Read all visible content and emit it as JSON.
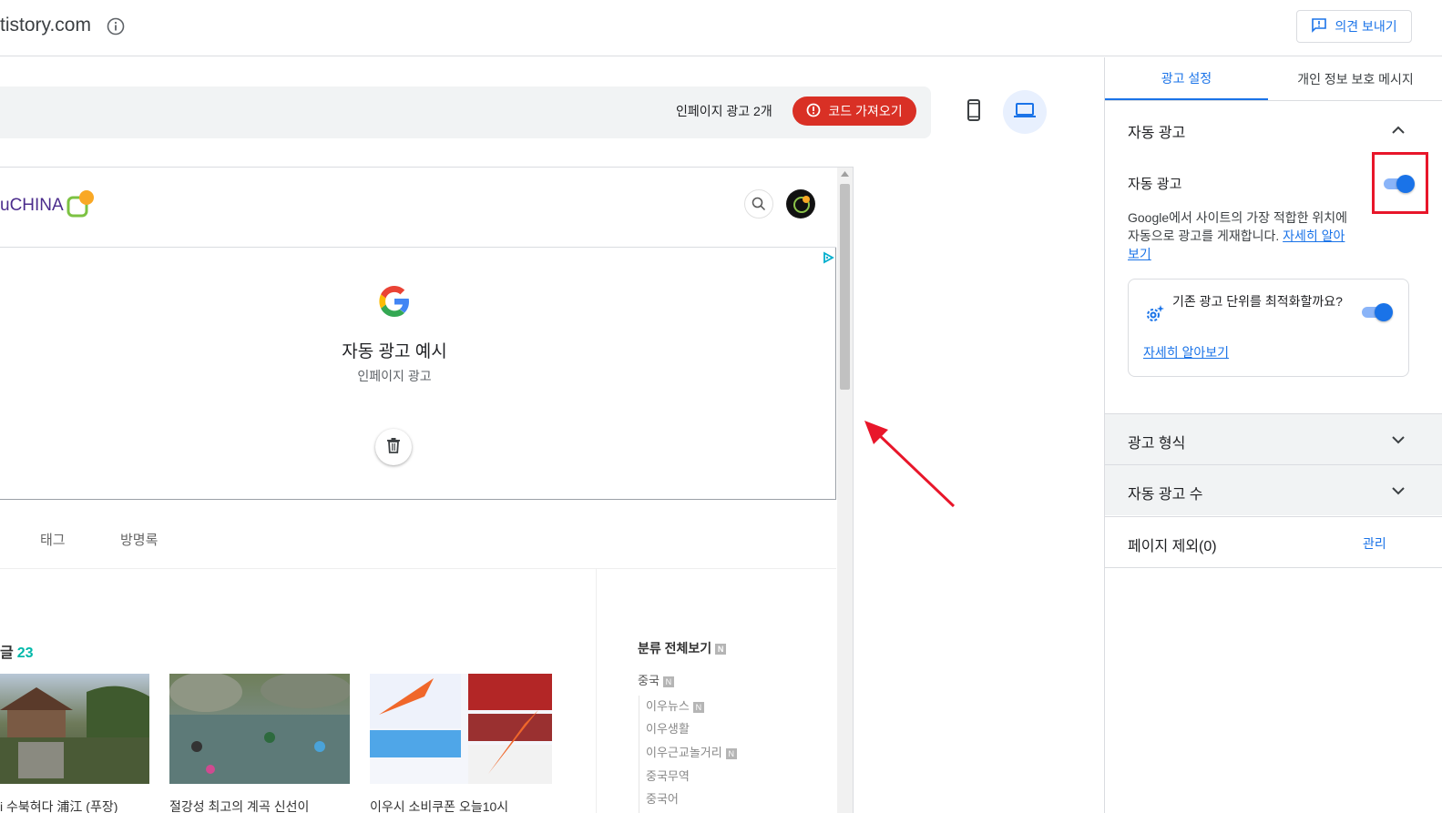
{
  "header": {
    "site_title": "tistory.com",
    "feedback_label": "의견 보내기"
  },
  "preview": {
    "inpage_count_label": "인페이지 광고 2개",
    "code_button_label": "코드 가져오기"
  },
  "blog": {
    "logo_text": "uCHINA",
    "ad": {
      "title": "자동 광고 예시",
      "subtitle": "인페이지 광고"
    },
    "nav": [
      "태그",
      "방명록"
    ],
    "posts_heading": "글",
    "posts_count": "23",
    "post_titles": [
      "i 수북혀다 浦江 (푸장)",
      "절강성 최고의 계곡 신선이",
      "이우시 소비쿠폰 오늘10시"
    ],
    "categories": {
      "title": "분류 전체보기",
      "main": "중국",
      "subs": [
        "이우뉴스",
        "이우생활",
        "이우근교놀거리",
        "중국무역",
        "중국어"
      ],
      "new_badge": "N"
    }
  },
  "side": {
    "tabs": [
      "광고 설정",
      "개인 정보 보호 메시지"
    ],
    "auto_ads_section_title": "자동 광고",
    "auto_ads_toggle_label": "자동 광고",
    "auto_ads_toggle_on": true,
    "auto_ads_description": "Google에서 사이트의 가장 적합한 위치에 자동으로 광고를 게재합니다. ",
    "learn_more": "자세히 알아보기",
    "optimize_card": {
      "text": "기존 광고 단위를 최적화할까요?",
      "link": "자세히 알아보기",
      "toggle_on": true
    },
    "ad_format_title": "광고 형식",
    "ad_count_title": "자동 광고 수",
    "page_exclusion_title": "페이지 제외(0)",
    "manage_label": "관리"
  },
  "colors": {
    "accent": "#1a73e8",
    "danger": "#d93025",
    "highlight": "#e8162a"
  }
}
